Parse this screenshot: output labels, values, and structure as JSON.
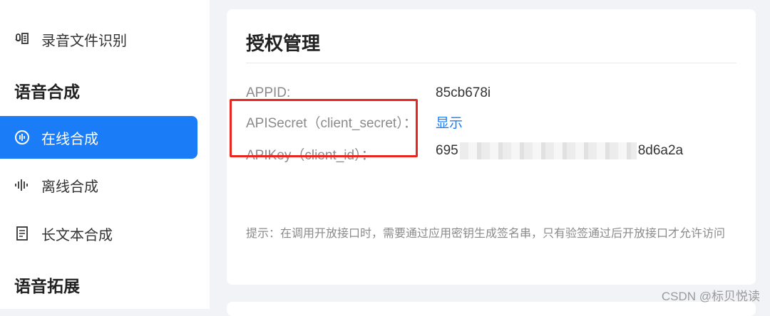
{
  "sidebar": {
    "items": [
      {
        "label": "录音文件识别",
        "icon": "voice-file-icon"
      },
      {
        "label": "在线合成",
        "icon": "online-synthesis-icon",
        "active": true
      },
      {
        "label": "离线合成",
        "icon": "waveform-icon"
      },
      {
        "label": "长文本合成",
        "icon": "document-icon"
      }
    ],
    "sections": [
      "语音合成",
      "语音拓展"
    ]
  },
  "card": {
    "title": "授权管理",
    "rows": [
      {
        "label": "APPID:",
        "value": "85cb678i"
      },
      {
        "label": "APISecret（client_secret）：",
        "value": "显示"
      },
      {
        "label": "APIKey（client_id）：",
        "value_prefix": "695",
        "value_suffix": "8d6a2a"
      }
    ],
    "tip": "提示：在调用开放接口时，需要通过应用密钥生成签名串，只有验签通过后开放接口才允许访问"
  },
  "watermark": "CSDN @标贝悦读",
  "colors": {
    "accent": "#1a7cf7",
    "highlight_border": "#e8261f"
  }
}
